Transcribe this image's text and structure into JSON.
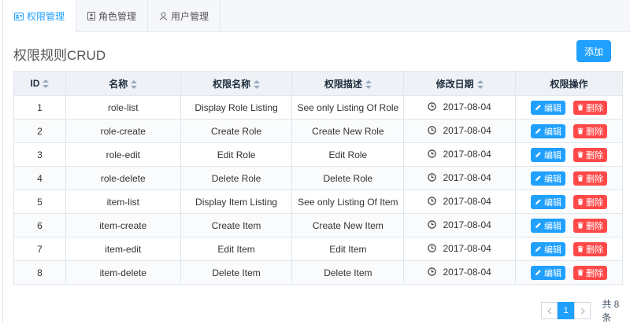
{
  "tabs": [
    {
      "label": "权限管理",
      "icon": "id-card-icon",
      "active": true
    },
    {
      "label": "角色管理",
      "icon": "user-square-icon",
      "active": false
    },
    {
      "label": "用户管理",
      "icon": "user-icon",
      "active": false
    }
  ],
  "page_title": "权限规则CRUD",
  "add_label": "添加",
  "columns": [
    "ID",
    "名称",
    "权限名称",
    "权限描述",
    "修改日期",
    "权限操作"
  ],
  "rows": [
    {
      "id": "1",
      "name": "role-list",
      "perm_name": "Display Role Listing",
      "desc": "See only Listing Of Role",
      "date": "2017-08-04"
    },
    {
      "id": "2",
      "name": "role-create",
      "perm_name": "Create Role",
      "desc": "Create New Role",
      "date": "2017-08-04"
    },
    {
      "id": "3",
      "name": "role-edit",
      "perm_name": "Edit Role",
      "desc": "Edit Role",
      "date": "2017-08-04"
    },
    {
      "id": "4",
      "name": "role-delete",
      "perm_name": "Delete Role",
      "desc": "Delete Role",
      "date": "2017-08-04"
    },
    {
      "id": "5",
      "name": "item-list",
      "perm_name": "Display Item Listing",
      "desc": "See only Listing Of Item",
      "date": "2017-08-04"
    },
    {
      "id": "6",
      "name": "item-create",
      "perm_name": "Create Item",
      "desc": "Create New Item",
      "date": "2017-08-04"
    },
    {
      "id": "7",
      "name": "item-edit",
      "perm_name": "Edit Item",
      "desc": "Edit Item",
      "date": "2017-08-04"
    },
    {
      "id": "8",
      "name": "item-delete",
      "perm_name": "Delete Item",
      "desc": "Delete Item",
      "date": "2017-08-04"
    }
  ],
  "actions": {
    "edit_label": "编辑",
    "delete_label": "删除"
  },
  "pagination": {
    "current_page": "1",
    "total_text": "共 8 条"
  },
  "colors": {
    "primary": "#20a0ff",
    "danger": "#ff4949"
  }
}
